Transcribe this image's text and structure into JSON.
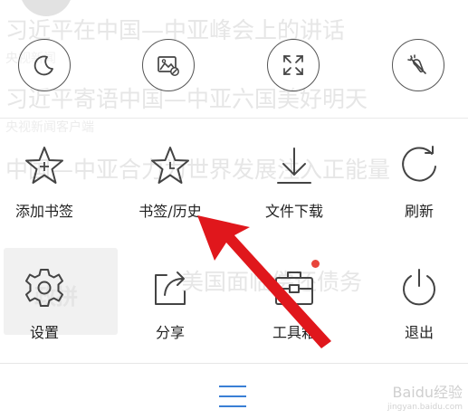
{
  "background": {
    "headlines": [
      "习近平在中国—中亚峰会上的讲话",
      "习近平寄语中国—中亚六国美好明天",
      "中国—中亚合力为世界发展注入正能量"
    ],
    "sources": [
      "央视新闻",
      "央视新闻客户端"
    ],
    "mid_headline": "美国面临偿还债务",
    "thumb_text": "政拼"
  },
  "toggles": [
    {
      "icon": "moon-icon"
    },
    {
      "icon": "no-image-icon"
    },
    {
      "icon": "fullscreen-icon"
    },
    {
      "icon": "no-trace-icon"
    }
  ],
  "menu": {
    "add_bookmark": "添加书签",
    "bookmarks_history": "书签/历史",
    "downloads": "文件下载",
    "refresh": "刷新",
    "settings": "设置",
    "share": "分享",
    "toolbox": "工具箱",
    "exit": "退出"
  },
  "watermark": {
    "brand": "Baidu经验",
    "url": "jingyan.baidu.com"
  },
  "colors": {
    "accent": "#3a7fd5",
    "badge": "#e8453c",
    "arrow": "#e0171c",
    "icon_stroke": "#444444"
  }
}
